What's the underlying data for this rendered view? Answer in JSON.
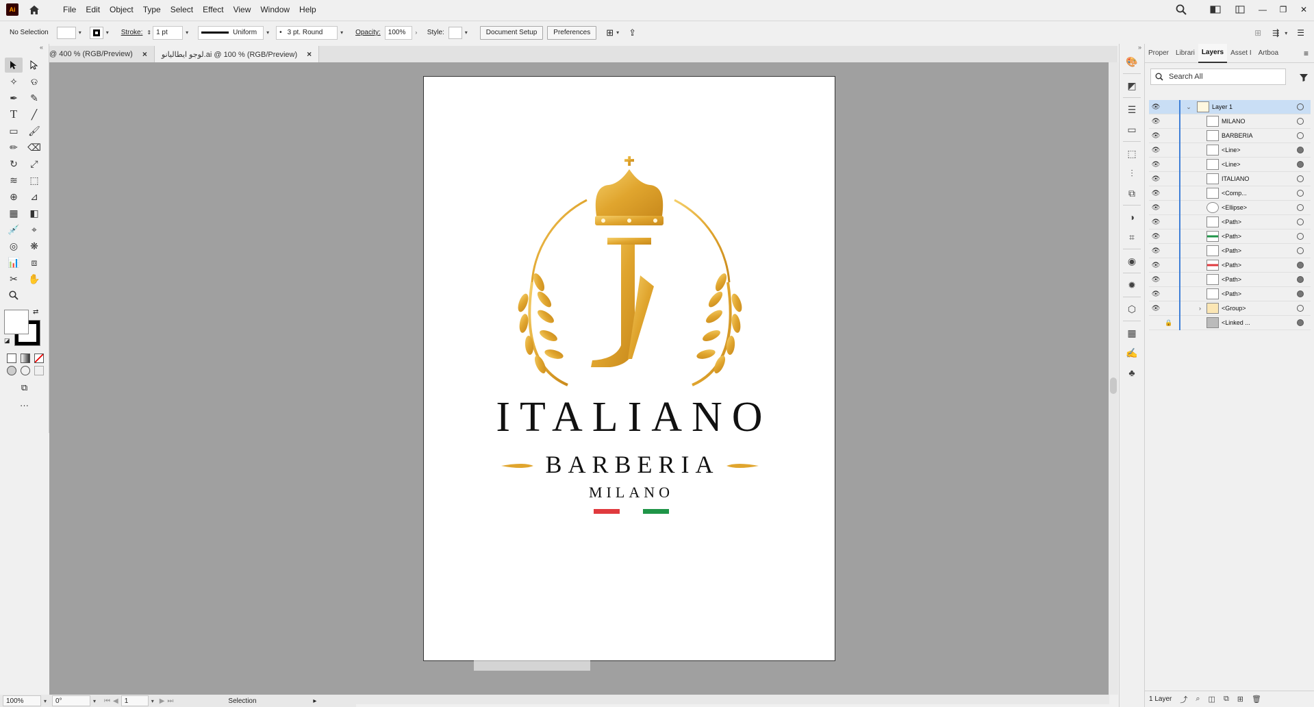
{
  "menu": {
    "app_logo": "Ai",
    "items": [
      "File",
      "Edit",
      "Object",
      "Type",
      "Select",
      "Effect",
      "View",
      "Window",
      "Help"
    ]
  },
  "window_controls": {
    "minimize": "—",
    "restore": "❐",
    "close": "✕"
  },
  "control_bar": {
    "selection_label": "No Selection",
    "stroke_label": "Stroke:",
    "stroke_weight": "1 pt",
    "profile": "Uniform",
    "brush": "3 pt. Round",
    "opacity_label": "Opacity:",
    "opacity_value": "100%",
    "style_label": "Style:",
    "doc_setup": "Document Setup",
    "preferences": "Preferences"
  },
  "tabs": [
    {
      "label": "@ 400 % (RGB/Preview)",
      "close": "×"
    },
    {
      "label": "لوجو ايطاليانو.ai @ 100 % (RGB/Preview)",
      "close": "×"
    }
  ],
  "artboard": {
    "title": "ITALIANO",
    "subtitle": "BARBERIA",
    "city": "MILANO",
    "gold": "#e7b23a",
    "flag_red": "#e03a3e",
    "flag_green": "#1f9548"
  },
  "status": {
    "zoom": "100%",
    "rotation": "0°",
    "artboard_num": "1",
    "tool": "Selection"
  },
  "layers_panel": {
    "tabs": [
      "Proper",
      "Librari",
      "Layers",
      "Asset I",
      "Artboa"
    ],
    "search_placeholder": "Search All",
    "rows": [
      {
        "name": "Layer 1"
      },
      {
        "name": "MILANO"
      },
      {
        "name": "BARBERIA"
      },
      {
        "name": "<Line>"
      },
      {
        "name": "<Line>"
      },
      {
        "name": "ITALIANO"
      },
      {
        "name": "<Comp..."
      },
      {
        "name": "<Ellipse>"
      },
      {
        "name": "<Path>"
      },
      {
        "name": "<Path>"
      },
      {
        "name": "<Path>"
      },
      {
        "name": "<Path>"
      },
      {
        "name": "<Path>"
      },
      {
        "name": "<Path>"
      },
      {
        "name": "<Group>"
      },
      {
        "name": "<Linked ..."
      }
    ],
    "footer": "1 Layer"
  }
}
